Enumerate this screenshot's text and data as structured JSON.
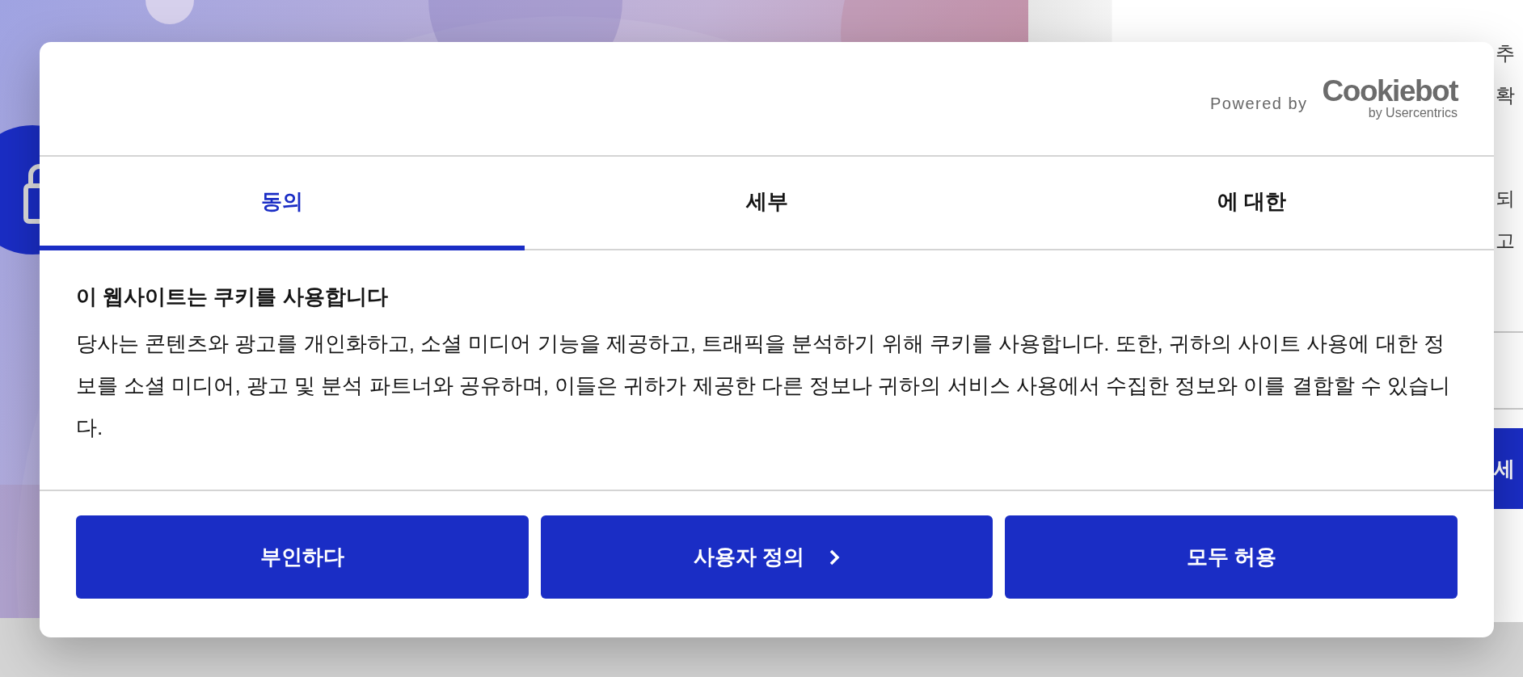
{
  "background": {
    "fragments": [
      {
        "text": "추"
      },
      {
        "text": "확"
      },
      {
        "text": "되"
      },
      {
        "text": "고"
      }
    ],
    "button_fragment": "세"
  },
  "dialog": {
    "powered_by": "Powered by",
    "logo": {
      "name": "Cookiebot",
      "tagline": "by Usercentrics"
    },
    "tabs": [
      {
        "label": "동의",
        "selected": true
      },
      {
        "label": "세부",
        "selected": false
      },
      {
        "label": "에 대한",
        "selected": false
      }
    ],
    "title": "이 웹사이트는 쿠키를 사용합니다",
    "body": "당사는 콘텐츠와 광고를 개인화하고, 소셜 미디어 기능을 제공하고, 트래픽을 분석하기 위해 쿠키를 사용합니다. 또한, 귀하의 사이트 사용에 대한 정보를 소셜 미디어, 광고 및 분석 파트너와 공유하며, 이들은 귀하가 제공한 다른 정보나 귀하의 서비스 사용에서 수집한 정보와 이를 결합할 수 있습니다.",
    "buttons": [
      {
        "label": "부인하다",
        "chevron": false
      },
      {
        "label": "사용자 정의",
        "chevron": true
      },
      {
        "label": "모두 허용",
        "chevron": false
      }
    ]
  }
}
